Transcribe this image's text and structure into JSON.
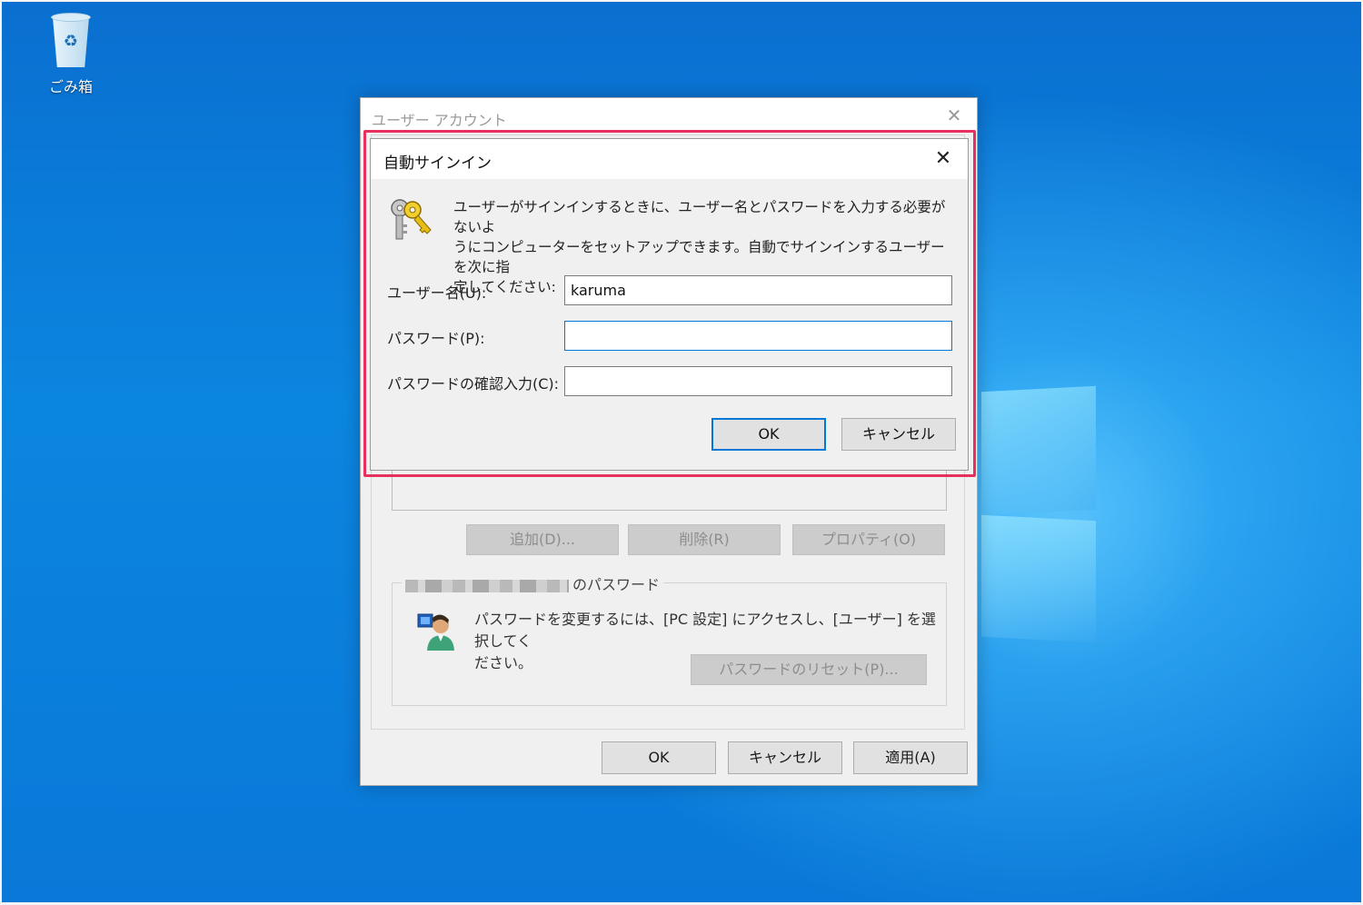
{
  "desktop": {
    "recycle_bin_label": "ごみ箱"
  },
  "parent_window": {
    "title": "ユーザー アカウント",
    "buttons": {
      "add": "追加(D)...",
      "remove": "削除(R)",
      "properties": "プロパティ(O)"
    },
    "password_group": {
      "legend_suffix": "のパスワード",
      "text_line1": "パスワードを変更するには、[PC 設定] にアクセスし、[ユーザー] を選択してく",
      "text_line2": "ださい。",
      "reset_button": "パスワードのリセット(P)..."
    },
    "footer": {
      "ok": "OK",
      "cancel": "キャンセル",
      "apply": "適用(A)"
    }
  },
  "dialog": {
    "title": "自動サインイン",
    "description_line1": "ユーザーがサインインするときに、ユーザー名とパスワードを入力する必要がないよ",
    "description_line2": "うにコンピューターをセットアップできます。自動でサインインするユーザーを次に指",
    "description_line3": "定してください:",
    "username_label": "ユーザー名(U):",
    "username_value": "karuma",
    "password_label": "パスワード(P):",
    "password_value": "",
    "confirm_label": "パスワードの確認入力(C):",
    "confirm_value": "",
    "ok": "OK",
    "cancel": "キャンセル"
  },
  "colors": {
    "highlight": "#e8305f",
    "focus_border": "#0078d7",
    "desktop_blue": "#0b86e0"
  },
  "icons": [
    "recycle-bin-icon",
    "close-icon",
    "keys-icon",
    "user-icon"
  ]
}
